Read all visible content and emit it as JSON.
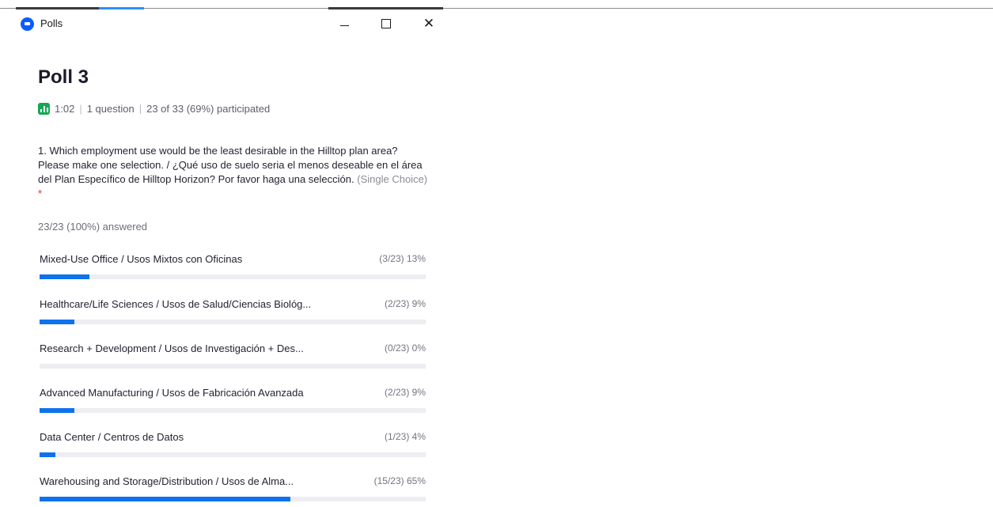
{
  "window": {
    "title": "Polls",
    "minimize_label": "–",
    "maximize_label": "□",
    "close_label": "✕"
  },
  "poll": {
    "title": "Poll 3",
    "duration": "1:02",
    "question_count": "1 question",
    "participation": "23 of 33 (69%) participated"
  },
  "question": {
    "text": "1. Which employment use would be the least desirable in the Hilltop plan area? Please make one selection. / ¿Qué uso de suelo seria el menos deseable en el área del Plan Específico de Hilltop Horizon? Por favor haga una selección.",
    "type": "(Single Choice)",
    "required_mark": "*",
    "answered": "23/23 (100%) answered"
  },
  "options": [
    {
      "label": "Mixed-Use Office / Usos Mixtos con Oficinas",
      "stats": "(3/23) 13%",
      "fraction": 0.13
    },
    {
      "label": "Healthcare/Life Sciences / Usos de Salud/Ciencias Biológ...",
      "stats": "(2/23) 9%",
      "fraction": 0.09
    },
    {
      "label": "Research + Development / Usos de Investigación + Des...",
      "stats": "(0/23) 0%",
      "fraction": 0.0
    },
    {
      "label": "Advanced Manufacturing / Usos de Fabricación Avanzada",
      "stats": "(2/23) 9%",
      "fraction": 0.09
    },
    {
      "label": "Data Center / Centros de Datos",
      "stats": "(1/23) 4%",
      "fraction": 0.04
    },
    {
      "label": "Warehousing and Storage/Distribution / Usos de Alma...",
      "stats": "(15/23) 65%",
      "fraction": 0.65
    }
  ],
  "colors": {
    "bar_fill": "#0e72ed",
    "bar_track": "#ededf2",
    "required": "#e02828",
    "chart_icon": "#13a853"
  }
}
